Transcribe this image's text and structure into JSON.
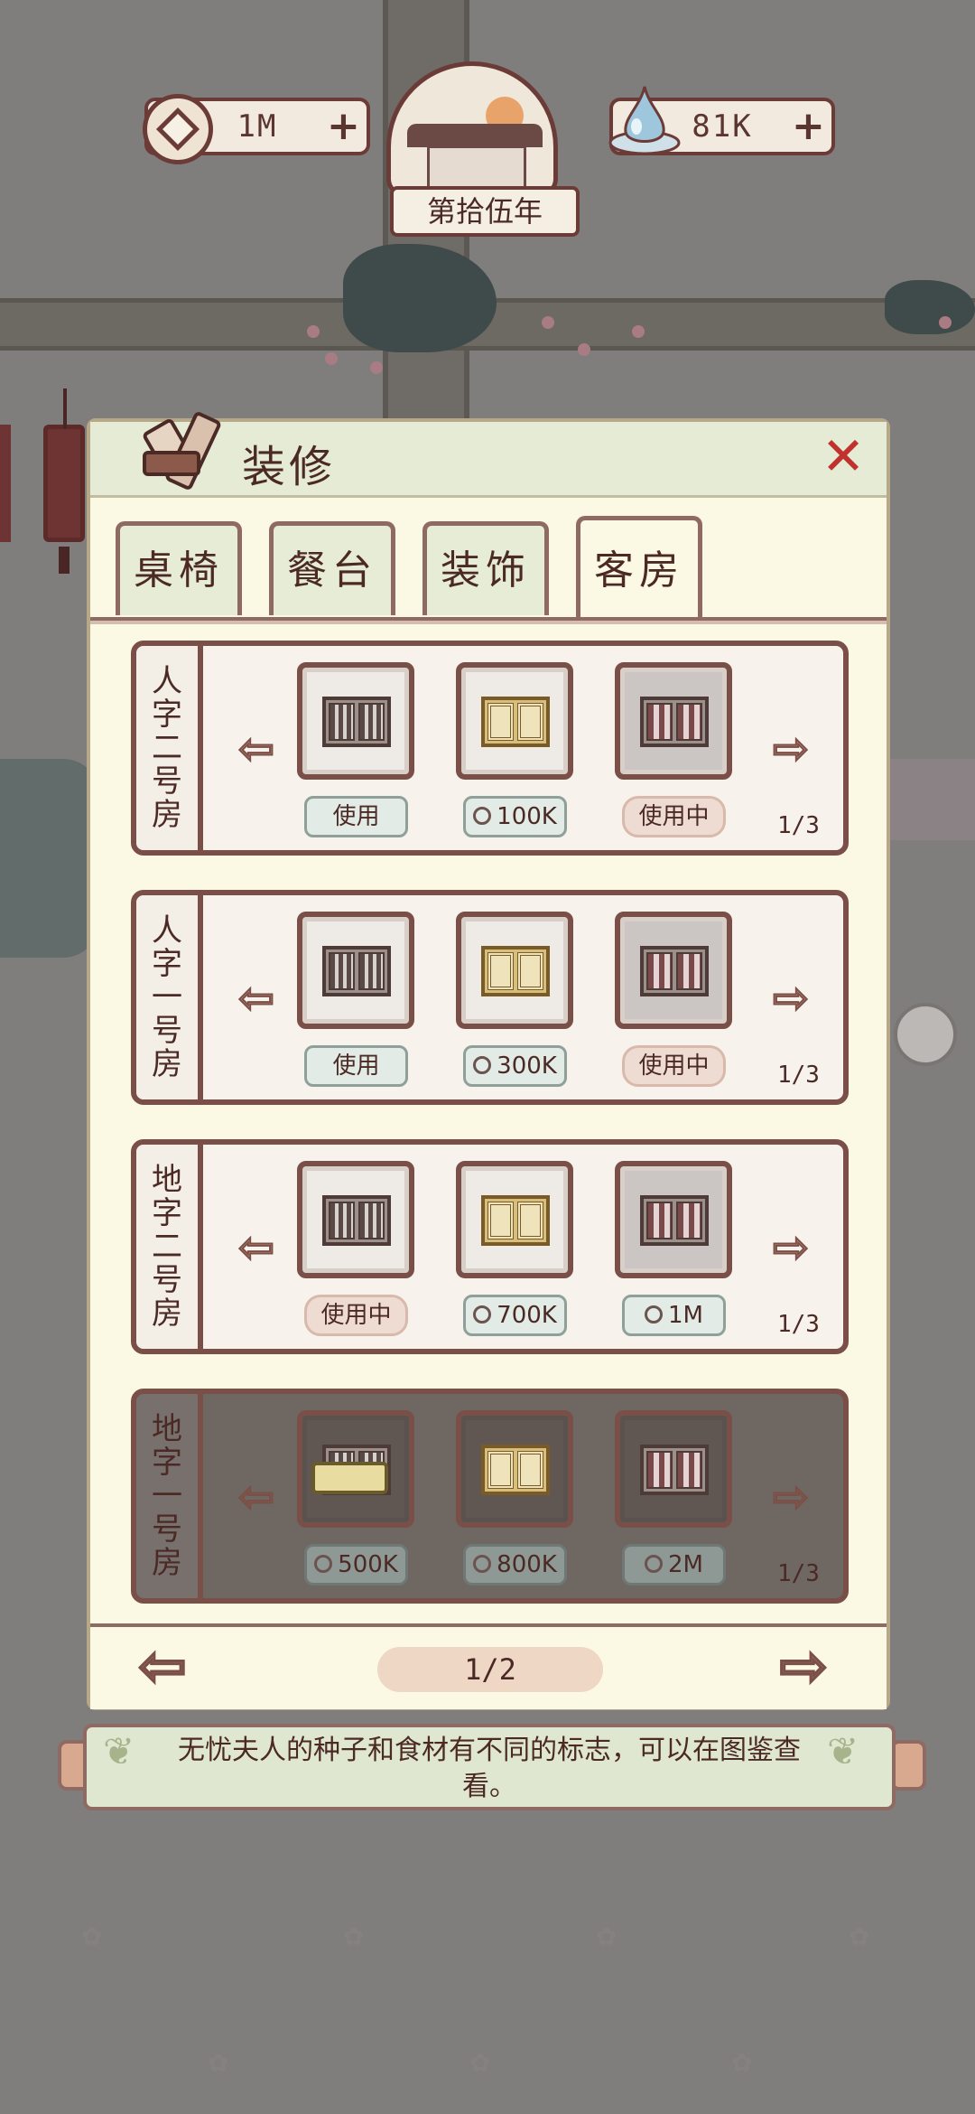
{
  "hud": {
    "coins": "1M",
    "spirit": "81K",
    "year": "第拾伍年"
  },
  "panel": {
    "title": "装修",
    "tabs": [
      "桌椅",
      "餐台",
      "装饰",
      "客房"
    ],
    "active_tab": 3,
    "rooms": [
      {
        "name": [
          "人",
          "字",
          "二",
          "号",
          "房"
        ],
        "buttons": [
          {
            "label": "使用",
            "type": "use"
          },
          {
            "label": "100K",
            "type": "price"
          },
          {
            "label": "使用中",
            "type": "using"
          }
        ],
        "page": "1/3",
        "locked": false
      },
      {
        "name": [
          "人",
          "字",
          "一",
          "号",
          "房"
        ],
        "buttons": [
          {
            "label": "使用",
            "type": "use"
          },
          {
            "label": "300K",
            "type": "price"
          },
          {
            "label": "使用中",
            "type": "using"
          }
        ],
        "page": "1/3",
        "locked": false
      },
      {
        "name": [
          "地",
          "字",
          "二",
          "号",
          "房"
        ],
        "buttons": [
          {
            "label": "使用中",
            "type": "using"
          },
          {
            "label": "700K",
            "type": "price"
          },
          {
            "label": "1M",
            "type": "price"
          }
        ],
        "page": "1/3",
        "locked": false
      },
      {
        "name": [
          "地",
          "字",
          "一",
          "号",
          "房"
        ],
        "buttons": [
          {
            "label": "500K",
            "type": "price"
          },
          {
            "label": "800K",
            "type": "price"
          },
          {
            "label": "2M",
            "type": "price"
          }
        ],
        "page": "1/3",
        "locked": true
      }
    ],
    "pager": "1/2",
    "tip": "无忧夫人的种子和食材有不同的标志，可以在图鉴查看。"
  },
  "colors": {
    "close": "#c0322d",
    "frame": "#7a4f47",
    "panel_bg": "#fbf8e4",
    "header_bg": "#e5ebd4"
  }
}
